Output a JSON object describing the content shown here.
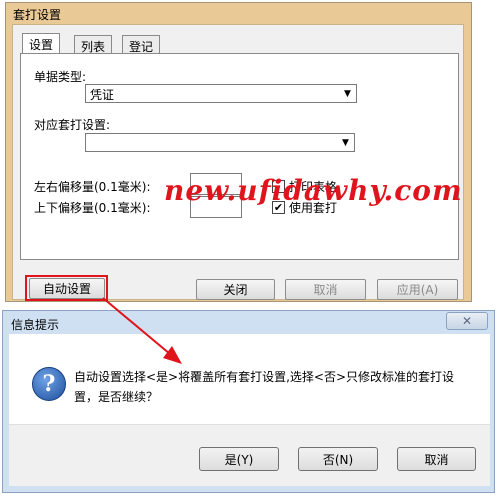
{
  "main_window": {
    "title": "套打设置",
    "tabs": [
      {
        "label": "设置",
        "active": true
      },
      {
        "label": "列表",
        "active": false
      },
      {
        "label": "登记",
        "active": false
      }
    ],
    "doc_type_label": "单据类型:",
    "doc_type_value": "凭证",
    "print_setting_label": "对应套打设置:",
    "print_setting_value": "",
    "lr_offset_label": "左右偏移量(0.1毫米):",
    "ud_offset_label": "上下偏移量(0.1毫米):",
    "print_form_label": "打印表格",
    "print_form_checked": false,
    "use_template_label": "使用套打",
    "use_template_checked": true,
    "auto_setup_button": "自动设置",
    "close_button": "关闭",
    "cancel_button": "取消",
    "apply_button": "应用(A)",
    "watermark": "new.ufidawhy.com"
  },
  "dialog": {
    "title": "信息提示",
    "message": "自动设置选择<是>将覆盖所有套打设置,选择<否>只修改标准的套打设置，是否继续？",
    "yes_button": "是(Y)",
    "no_button": "否(N)",
    "cancel_button": "取消"
  },
  "colors": {
    "annotation": "#e0141c",
    "window_frame": "#e9c995",
    "dialog_frame": "#cfe0f3"
  }
}
